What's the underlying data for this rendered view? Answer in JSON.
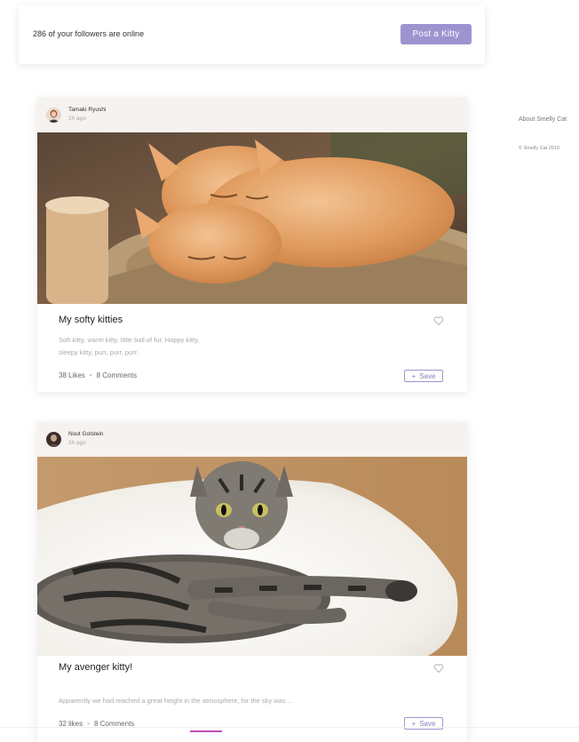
{
  "header": {
    "online_text": "286 of your followers are online",
    "post_button": "Post a Kitty"
  },
  "sidebar": {
    "about": "About Smelly Cat",
    "copyright": "© Smelly Cat 2019"
  },
  "posts": [
    {
      "author": "Tamaki Ryushi",
      "time": "2h ago",
      "title": "My softy kitties",
      "description": "Soft kitty, warm kitty, little ball of fur. Happy kitty, sleepy kitty, purr, purr, purr.",
      "likes": "38 Likes",
      "comments": "8 Comments",
      "save_label": "Save"
    },
    {
      "author": "Nout Golstein",
      "time": "2h ago",
      "title": "My avenger kitty!",
      "description": "Apparently we had reached a great height in the atmosphere, for the sky was ...",
      "likes": "32 likes",
      "comments": "8 Comments",
      "save_label": "Save"
    }
  ],
  "colors": {
    "accent": "#9c94cf",
    "bottom_accent": "#c04db8"
  }
}
